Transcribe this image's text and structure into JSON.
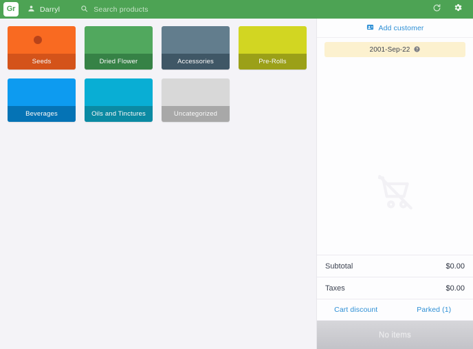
{
  "app": {
    "logo_text": "Gr",
    "accent_green": "#4da354",
    "link_blue": "#2d8fd5",
    "banner_yellow": "#fcf1cf"
  },
  "header": {
    "user_name": "Darryl",
    "user_icon": "person-icon",
    "search_placeholder": "Search products",
    "search_value": "",
    "search_icon": "search-icon",
    "refresh_icon": "refresh-icon",
    "settings_icon": "gear-icon"
  },
  "products": {
    "categories": [
      {
        "label": "Seeds",
        "body_color": "#f96a21",
        "label_color": "#d4531a",
        "thumb_color": "#b8431a",
        "has_thumb": true
      },
      {
        "label": "Dried Flower",
        "body_color": "#51a85e",
        "label_color": "#368246",
        "thumb_color": "",
        "has_thumb": false
      },
      {
        "label": "Accessories",
        "body_color": "#627d8d",
        "label_color": "#3f5766",
        "thumb_color": "",
        "has_thumb": false
      },
      {
        "label": "Pre-Rolls",
        "body_color": "#d2d622",
        "label_color": "#9ba018",
        "thumb_color": "",
        "has_thumb": false
      },
      {
        "label": "Beverages",
        "body_color": "#0d9bf0",
        "label_color": "#0573b5",
        "thumb_color": "",
        "has_thumb": false
      },
      {
        "label": "Oils and Tinctures",
        "body_color": "#09aed4",
        "label_color": "#0b8aa3",
        "thumb_color": "",
        "has_thumb": false
      },
      {
        "label": "Uncategorized",
        "body_color": "#d8d8d8",
        "label_color": "#a8a8a8",
        "thumb_color": "",
        "has_thumb": false
      }
    ]
  },
  "cart": {
    "add_customer_label": "Add customer",
    "add_customer_icon": "contact-card-icon",
    "date_banner_text": "2001-Sep-22",
    "date_banner_icon": "help-icon",
    "empty_cart_icon": "cart-off-icon",
    "totals": [
      {
        "label": "Subtotal",
        "value": "$0.00"
      },
      {
        "label": "Taxes",
        "value": "$0.00"
      }
    ],
    "cart_discount_label": "Cart discount",
    "parked_label": "Parked (1)",
    "checkout_label": "No items"
  }
}
